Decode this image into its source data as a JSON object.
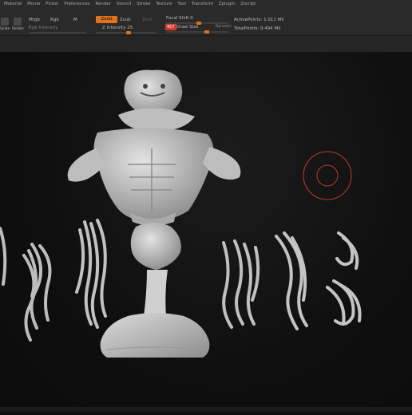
{
  "menu": [
    "Material",
    "Movie",
    "Picker",
    "Preferences",
    "Render",
    "Stencil",
    "Stroke",
    "Texture",
    "Tool",
    "Transform",
    "Zplugin",
    "Zscript"
  ],
  "toolbar": {
    "btn_left_label": "Scale",
    "btn_rotate_label": "Rotate",
    "mrgb": "Mrgb",
    "rgb": "Rgb",
    "m": "M",
    "rgb_intensity": "Rgb Intensity",
    "zadd": "Zadd",
    "zsub": "Zsub",
    "zcut": "Zcut",
    "z_intensity": "Z Intensity 25",
    "focal_shift": "Focal Shift 0",
    "draw_size_value": "457",
    "draw_size": "Draw Size",
    "dynamic": "Dynamic",
    "active_points": "ActivePoints: 1.011 Mil",
    "total_points": "TotalPoints: 9.494 Mil"
  },
  "colors": {
    "accent": "#e0721d",
    "brush_cursor": "#c0392b",
    "sculpt": "#c9c9c9"
  }
}
